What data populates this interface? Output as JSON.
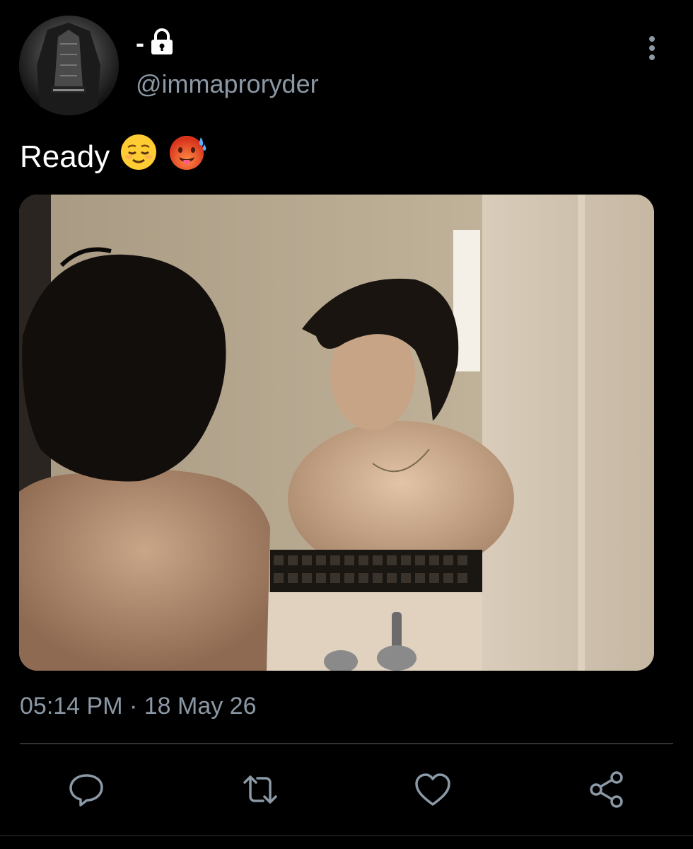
{
  "user": {
    "display_name": "-",
    "handle": "@immaproryder",
    "protected": true,
    "avatar_icon": "profile-avatar"
  },
  "tweet": {
    "text": "Ready",
    "emojis": [
      "relieved-face-emoji",
      "hot-face-emoji"
    ],
    "media_icon": "photo",
    "timestamp": "05:14 PM · 18 May 26"
  },
  "actions": [
    {
      "icon": "reply-icon"
    },
    {
      "icon": "retweet-icon"
    },
    {
      "icon": "like-icon"
    },
    {
      "icon": "share-icon"
    }
  ],
  "colors": {
    "background": "#000000",
    "primary_text": "#ffffff",
    "secondary_text": "#8b98a5",
    "divider": "#2f3336"
  }
}
